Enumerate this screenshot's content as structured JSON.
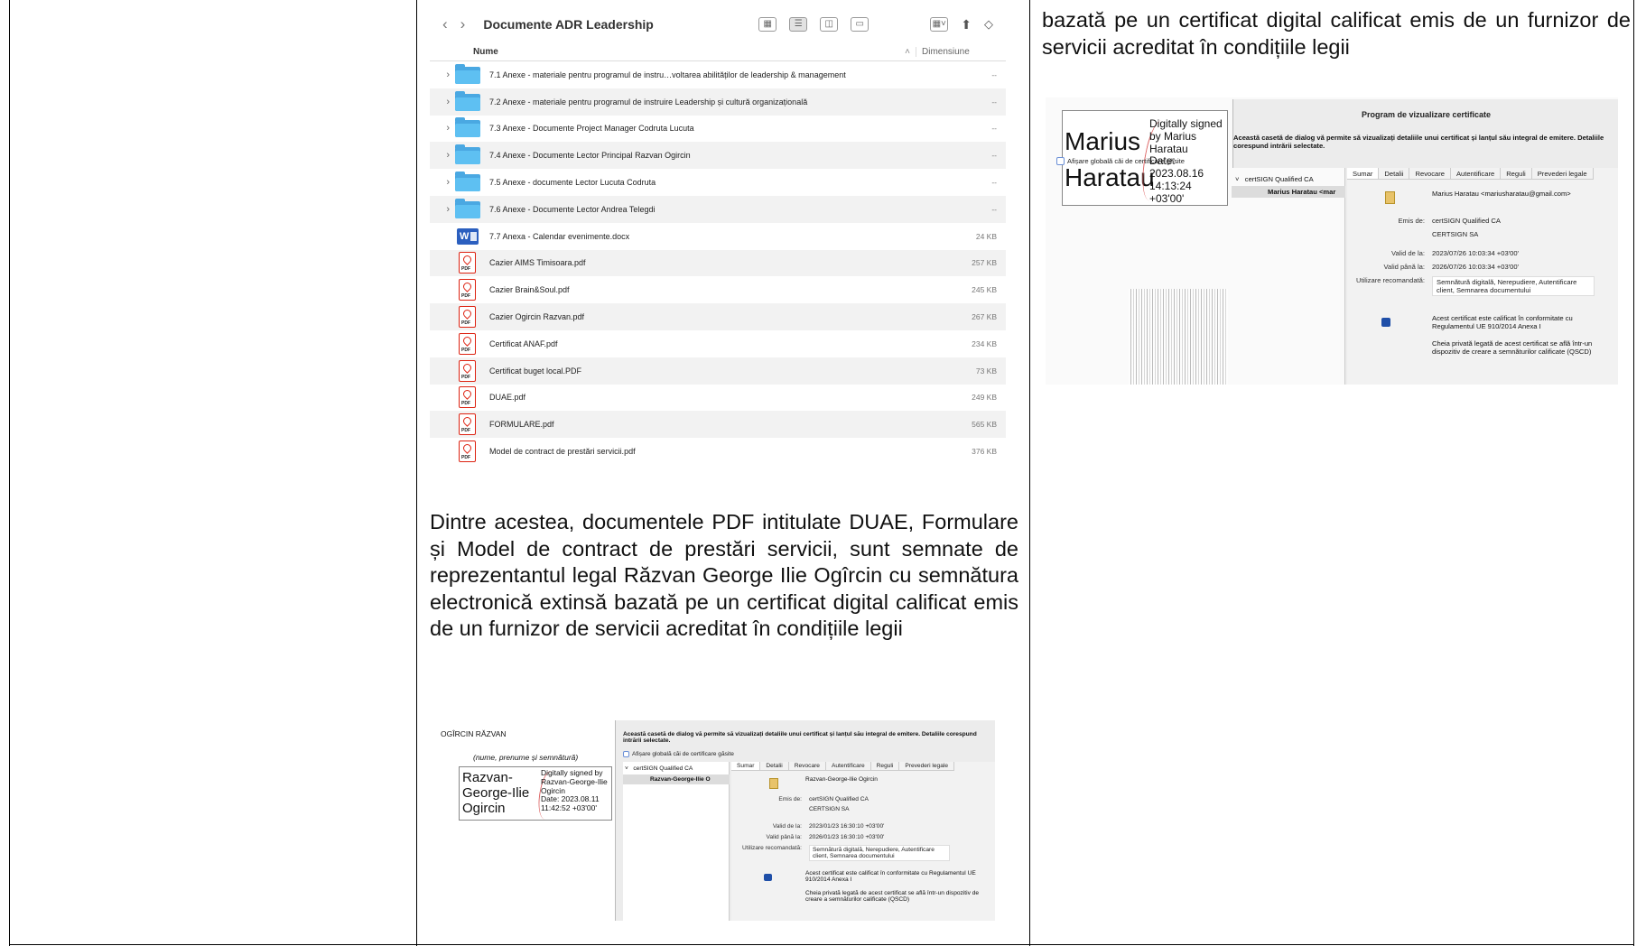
{
  "finder": {
    "title": "Documente ADR Leadership",
    "col_name": "Nume",
    "col_size": "Dimensiune",
    "rows": [
      {
        "name": "7.1 Anexe - materiale pentru programul de instru…voltarea abilităților de leadership & management",
        "size": "--",
        "type": "folder"
      },
      {
        "name": "7.2 Anexe - materiale pentru programul de instruire Leadership și cultură organizațională",
        "size": "--",
        "type": "folder"
      },
      {
        "name": "7.3 Anexe - Documente Project Manager Codruta Lucuta",
        "size": "--",
        "type": "folder"
      },
      {
        "name": "7.4 Anexe - Documente Lector Principal Razvan Ogircin",
        "size": "--",
        "type": "folder"
      },
      {
        "name": "7.5 Anexe - documente Lector Lucuta Codruta",
        "size": "--",
        "type": "folder"
      },
      {
        "name": "7.6 Anexe - Documente Lector Andrea Telegdi",
        "size": "--",
        "type": "folder"
      },
      {
        "name": "7.7 Anexa - Calendar evenimente.docx",
        "size": "24 KB",
        "type": "word"
      },
      {
        "name": "Cazier AIMS Timisoara.pdf",
        "size": "257 KB",
        "type": "pdf"
      },
      {
        "name": "Cazier Brain&Soul.pdf",
        "size": "245 KB",
        "type": "pdf"
      },
      {
        "name": "Cazier Ogircin Razvan.pdf",
        "size": "267 KB",
        "type": "pdf"
      },
      {
        "name": "Certificat ANAF.pdf",
        "size": "234 KB",
        "type": "pdf"
      },
      {
        "name": "Certificat buget local.PDF",
        "size": "73 KB",
        "type": "pdf"
      },
      {
        "name": "DUAE.pdf",
        "size": "249 KB",
        "type": "pdf"
      },
      {
        "name": "FORMULARE.pdf",
        "size": "565 KB",
        "type": "pdf"
      },
      {
        "name": "Model de contract de prestări servicii.pdf",
        "size": "376 KB",
        "type": "pdf"
      }
    ]
  },
  "middle_paragraph": "Dintre acestea, documentele PDF intitulate DUAE, Formulare și Model de contract de prestări servicii, sunt semnate de reprezentantul legal Răzvan George Ilie Ogîrcin cu semnătura electronică extinsă bazată pe un certificat digital calificat emis de un furnizor de servicii acreditat în condițiile legii",
  "right_paragraph": "bazată pe un certificat digital calificat emis de un furnizor de servicii acreditat în condițiile legii",
  "sig_razvan": {
    "header": "OGÎRCIN RĂZVAN",
    "caption": "(nume, prenume și semnătură)",
    "name_lines": [
      "Razvan-",
      "George-Ilie",
      "Ogircin"
    ],
    "details": [
      "Digitally signed by",
      "Razvan-George-Ilie",
      "Ogircin",
      "Date: 2023.08.11",
      "11:42:52 +03'00'"
    ],
    "dialog_desc": "Această casetă de dialog vă permite să vizualizați detaliile unui certificat și lanțul său integral de emitere. Detaliile corespund intrării selectate.",
    "checkbox": "Afișare globală căi de certificare găsite",
    "tree_root": "certSIGN Qualified CA",
    "tree_child": "Razvan-George-Ilie O",
    "tabs": [
      "Sumar",
      "Detalii",
      "Revocare",
      "Autentificare",
      "Reguli",
      "Prevederi legale"
    ],
    "subject": "Razvan-George-Ilie Ogircin",
    "issued_by_label": "Emis de:",
    "issued_by": [
      "certSIGN Qualified CA",
      "CERTSIGN SA"
    ],
    "valid_from_label": "Valid de la:",
    "valid_from": "2023/01/23 16:30:10 +03'00'",
    "valid_to_label": "Valid până la:",
    "valid_to": "2026/01/23 16:30:10 +03'00'",
    "usage_label": "Utilizare recomandată:",
    "usage": "Semnătură digitală, Nerepudiere, Autentificare client, Semnarea documentului",
    "qualified": "Acest certificat este calificat în conformitate cu Regulamentul UE 910/2014 Anexa I",
    "qscd": "Cheia privată legată de acest certificat se află într-un dispozitiv de creare a semnăturilor calificate (QSCD)"
  },
  "sig_marius": {
    "name_lines": [
      "Marius",
      "Haratau"
    ],
    "details": [
      "Digitally signed",
      "by Marius",
      "Haratau",
      "Date: 2023.08.16",
      "14:13:24 +03'00'"
    ],
    "dialog_title": "Program de vizualizare certificate",
    "dialog_desc": "Această casetă de dialog vă permite să vizualizați detaliile unui certificat și lanțul său integral de emitere. Detaliile corespund intrării selectate.",
    "checkbox": "Afișare globală căi de certificare găsite",
    "tree_root": "certSIGN Qualified CA",
    "tree_child": "Marius Haratau <mar",
    "tabs": [
      "Sumar",
      "Detalii",
      "Revocare",
      "Autentificare",
      "Reguli",
      "Prevederi legale"
    ],
    "subject": "Marius Haratau <mariusharatau@gmail.com>",
    "issued_by_label": "Emis de:",
    "issued_by": [
      "certSIGN Qualified CA",
      "CERTSIGN SA"
    ],
    "valid_from_label": "Valid de la:",
    "valid_from": "2023/07/26 10:03:34 +03'00'",
    "valid_to_label": "Valid până la:",
    "valid_to": "2026/07/26 10:03:34 +03'00'",
    "usage_label": "Utilizare recomandată:",
    "usage": "Semnătură digitală, Nerepudiere, Autentificare client, Semnarea documentului",
    "qualified": "Acest certificat este calificat în conformitate cu Regulamentul UE 910/2014 Anexa I",
    "qscd": "Cheia privată legată de acest certificat se află într-un dispozitiv de creare a semnăturilor calificate (QSCD)"
  }
}
